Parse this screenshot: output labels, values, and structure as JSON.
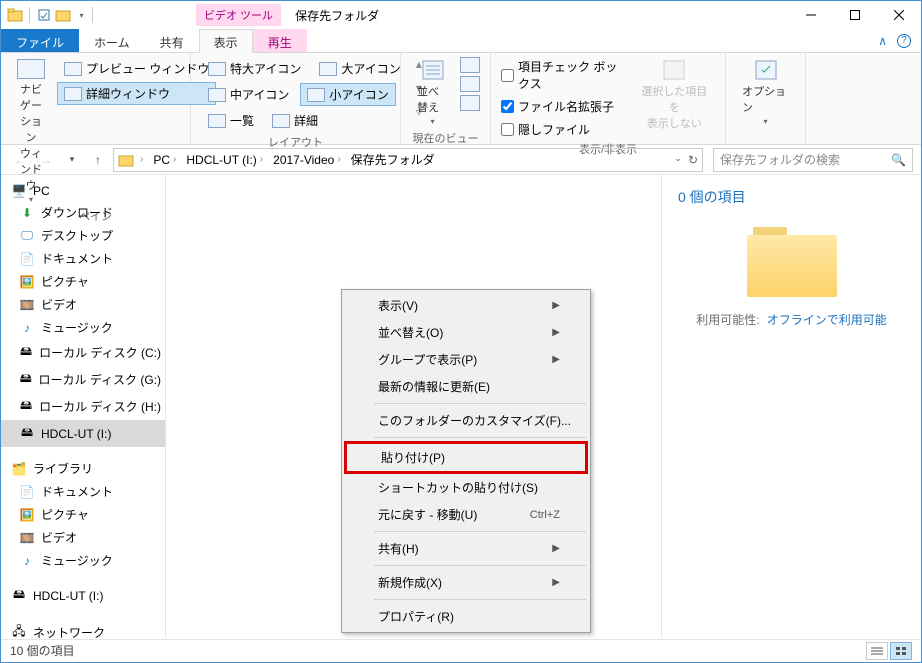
{
  "window": {
    "tools_label": "ビデオ ツール",
    "title": "保存先フォルダ"
  },
  "tabs": {
    "file": "ファイル",
    "home": "ホーム",
    "share": "共有",
    "view": "表示",
    "play": "再生"
  },
  "ribbon": {
    "panes": {
      "nav": "ナビゲーション\nウィンドウ",
      "preview": "プレビュー ウィンドウ",
      "details": "詳細ウィンドウ",
      "group_label": "ペイン"
    },
    "layout": {
      "extra_large": "特大アイコン",
      "large": "大アイコン",
      "medium": "中アイコン",
      "small": "小アイコン",
      "list": "一覧",
      "details": "詳細",
      "group_label": "レイアウト"
    },
    "current_view": {
      "sort": "並べ替え",
      "group_label": "現在のビュー"
    },
    "show_hide": {
      "checkboxes": "項目チェック ボックス",
      "extensions": "ファイル名拡張子",
      "hidden": "隠しファイル",
      "hide_selected": "選択した項目を\n表示しない",
      "group_label": "表示/非表示"
    },
    "options": "オプション"
  },
  "breadcrumb": {
    "items": [
      "PC",
      "HDCL-UT (I:)",
      "2017-Video",
      "保存先フォルダ"
    ]
  },
  "search": {
    "placeholder": "保存先フォルダの検索"
  },
  "tree": {
    "pc": "PC",
    "downloads": "ダウンロード",
    "desktop": "デスクトップ",
    "documents": "ドキュメント",
    "pictures": "ピクチャ",
    "videos": "ビデオ",
    "music": "ミュージック",
    "disk_c": "ローカル ディスク (C:)",
    "disk_g": "ローカル ディスク (G:)",
    "disk_h": "ローカル ディスク (H:)",
    "hdcl": "HDCL-UT (I:)",
    "libraries": "ライブラリ",
    "lib_docs": "ドキュメント",
    "lib_pics": "ピクチャ",
    "lib_video": "ビデオ",
    "lib_music": "ミュージック",
    "hdcl2": "HDCL-UT (I:)",
    "network": "ネットワーク"
  },
  "details": {
    "header": "0 個の項目",
    "avail_key": "利用可能性:",
    "avail_val": "オフラインで利用可能"
  },
  "context_menu": {
    "view": "表示(V)",
    "sort": "並べ替え(O)",
    "group": "グループで表示(P)",
    "refresh": "最新の情報に更新(E)",
    "customize": "このフォルダーのカスタマイズ(F)...",
    "paste": "貼り付け(P)",
    "paste_shortcut": "ショートカットの貼り付け(S)",
    "undo": "元に戻す - 移動(U)",
    "undo_key": "Ctrl+Z",
    "share": "共有(H)",
    "new": "新規作成(X)",
    "properties": "プロパティ(R)"
  },
  "status": {
    "text": "10 個の項目"
  }
}
